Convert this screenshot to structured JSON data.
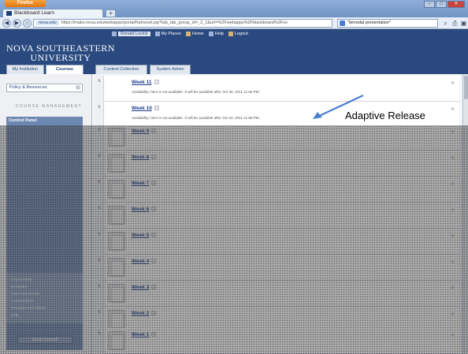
{
  "browser": {
    "app_button": "Firefox",
    "tab_title": "Blackboard Learn",
    "url_host": "nova.edu",
    "url": "https://mako.nova.edu/webapps/portal/frameset.jsp?tab_tab_group_id=_2_1&url=%2Fwebapps%2Fblackboard%2Fex",
    "search_text": "\"bimodal presentation\""
  },
  "header": {
    "logo_line1": "NOVA SOUTHEASTERN",
    "logo_line2": "UNIVERSITY",
    "nav_bar": "Ronald Lovick",
    "nav": [
      "My Places",
      "Home",
      "Help",
      "Logout"
    ]
  },
  "tabs": [
    "My Institution",
    "Courses",
    "Content Collection",
    "System Admin"
  ],
  "sidebar": {
    "policy_link": "Policy & Resources",
    "section_label": "COURSE MANAGEMENT",
    "panel_title": "Control Panel",
    "items": [
      "Course Tools",
      "Evaluation",
      "Users and Groups",
      "Customization",
      "Packages and Utilities",
      "Help"
    ],
    "quick_button": "Quick Unenroll"
  },
  "weeks": [
    {
      "title": "Week 11",
      "availability": "Availability: Item is not available. It will be available after Oct 30, 2011 11:59 PM."
    },
    {
      "title": "Week 10",
      "availability": "Availability: Item is not available. It will be available after Oct 23, 2011 11:59 PM."
    },
    {
      "title": "Week 9",
      "availability": ""
    },
    {
      "title": "Week 8",
      "availability": ""
    },
    {
      "title": "Week 7",
      "availability": ""
    },
    {
      "title": "Week 6",
      "availability": ""
    },
    {
      "title": "Week 5",
      "availability": ""
    },
    {
      "title": "Week 4",
      "availability": ""
    },
    {
      "title": "Week 3",
      "availability": ""
    },
    {
      "title": "Week 2",
      "availability": ""
    },
    {
      "title": "Week 1",
      "availability": ""
    }
  ],
  "annotation": {
    "label": "Adaptive Release",
    "arrow_color": "#4a7fd0"
  }
}
